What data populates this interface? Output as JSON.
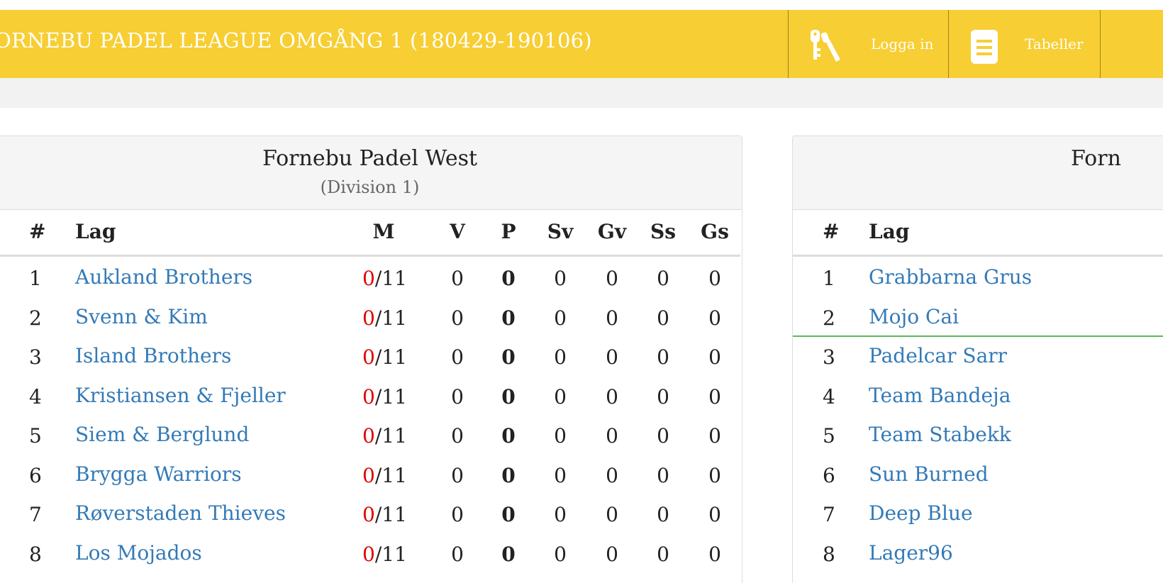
{
  "header": {
    "title": "ORNEBU PADEL LEAGUE OMGÅNG 1   (180429-190106)",
    "nav": [
      {
        "label": "Logga in",
        "icon": "key-icon"
      },
      {
        "label": "Tabeller",
        "icon": "document-icon"
      }
    ]
  },
  "colors": {
    "accent": "#f7ce33",
    "link": "#337ab7",
    "matches_played": "#e00000"
  },
  "table_left": {
    "title": "Fornebu Padel West",
    "subtitle": "(Division 1)",
    "columns": [
      "#",
      "Lag",
      "M",
      "V",
      "P",
      "Sv",
      "Gv",
      "Ss",
      "Gs"
    ],
    "rows": [
      {
        "rank": "1",
        "team": "Aukland Brothers",
        "played": "0",
        "total": "/11",
        "v": "0",
        "p": "0",
        "sv": "0",
        "gv": "0",
        "ss": "0",
        "gs": "0"
      },
      {
        "rank": "2",
        "team": "Svenn & Kim",
        "played": "0",
        "total": "/11",
        "v": "0",
        "p": "0",
        "sv": "0",
        "gv": "0",
        "ss": "0",
        "gs": "0"
      },
      {
        "rank": "3",
        "team": "Island Brothers",
        "played": "0",
        "total": "/11",
        "v": "0",
        "p": "0",
        "sv": "0",
        "gv": "0",
        "ss": "0",
        "gs": "0"
      },
      {
        "rank": "4",
        "team": "Kristiansen & Fjeller",
        "played": "0",
        "total": "/11",
        "v": "0",
        "p": "0",
        "sv": "0",
        "gv": "0",
        "ss": "0",
        "gs": "0"
      },
      {
        "rank": "5",
        "team": "Siem & Berglund",
        "played": "0",
        "total": "/11",
        "v": "0",
        "p": "0",
        "sv": "0",
        "gv": "0",
        "ss": "0",
        "gs": "0"
      },
      {
        "rank": "6",
        "team": "Brygga Warriors",
        "played": "0",
        "total": "/11",
        "v": "0",
        "p": "0",
        "sv": "0",
        "gv": "0",
        "ss": "0",
        "gs": "0"
      },
      {
        "rank": "7",
        "team": "Røverstaden Thieves",
        "played": "0",
        "total": "/11",
        "v": "0",
        "p": "0",
        "sv": "0",
        "gv": "0",
        "ss": "0",
        "gs": "0"
      },
      {
        "rank": "8",
        "team": "Los Mojados",
        "played": "0",
        "total": "/11",
        "v": "0",
        "p": "0",
        "sv": "0",
        "gv": "0",
        "ss": "0",
        "gs": "0"
      }
    ]
  },
  "table_right": {
    "title": "Forn",
    "columns": [
      "#",
      "Lag"
    ],
    "rows": [
      {
        "rank": "1",
        "team": "Grabbarna Grus"
      },
      {
        "rank": "2",
        "team": "Mojo Cai"
      },
      {
        "rank": "3",
        "team": "Padelcar Sarr"
      },
      {
        "rank": "4",
        "team": "Team Bandeja"
      },
      {
        "rank": "5",
        "team": "Team Stabekk"
      },
      {
        "rank": "6",
        "team": "Sun Burned"
      },
      {
        "rank": "7",
        "team": "Deep Blue"
      },
      {
        "rank": "8",
        "team": "Lager96"
      }
    ]
  }
}
